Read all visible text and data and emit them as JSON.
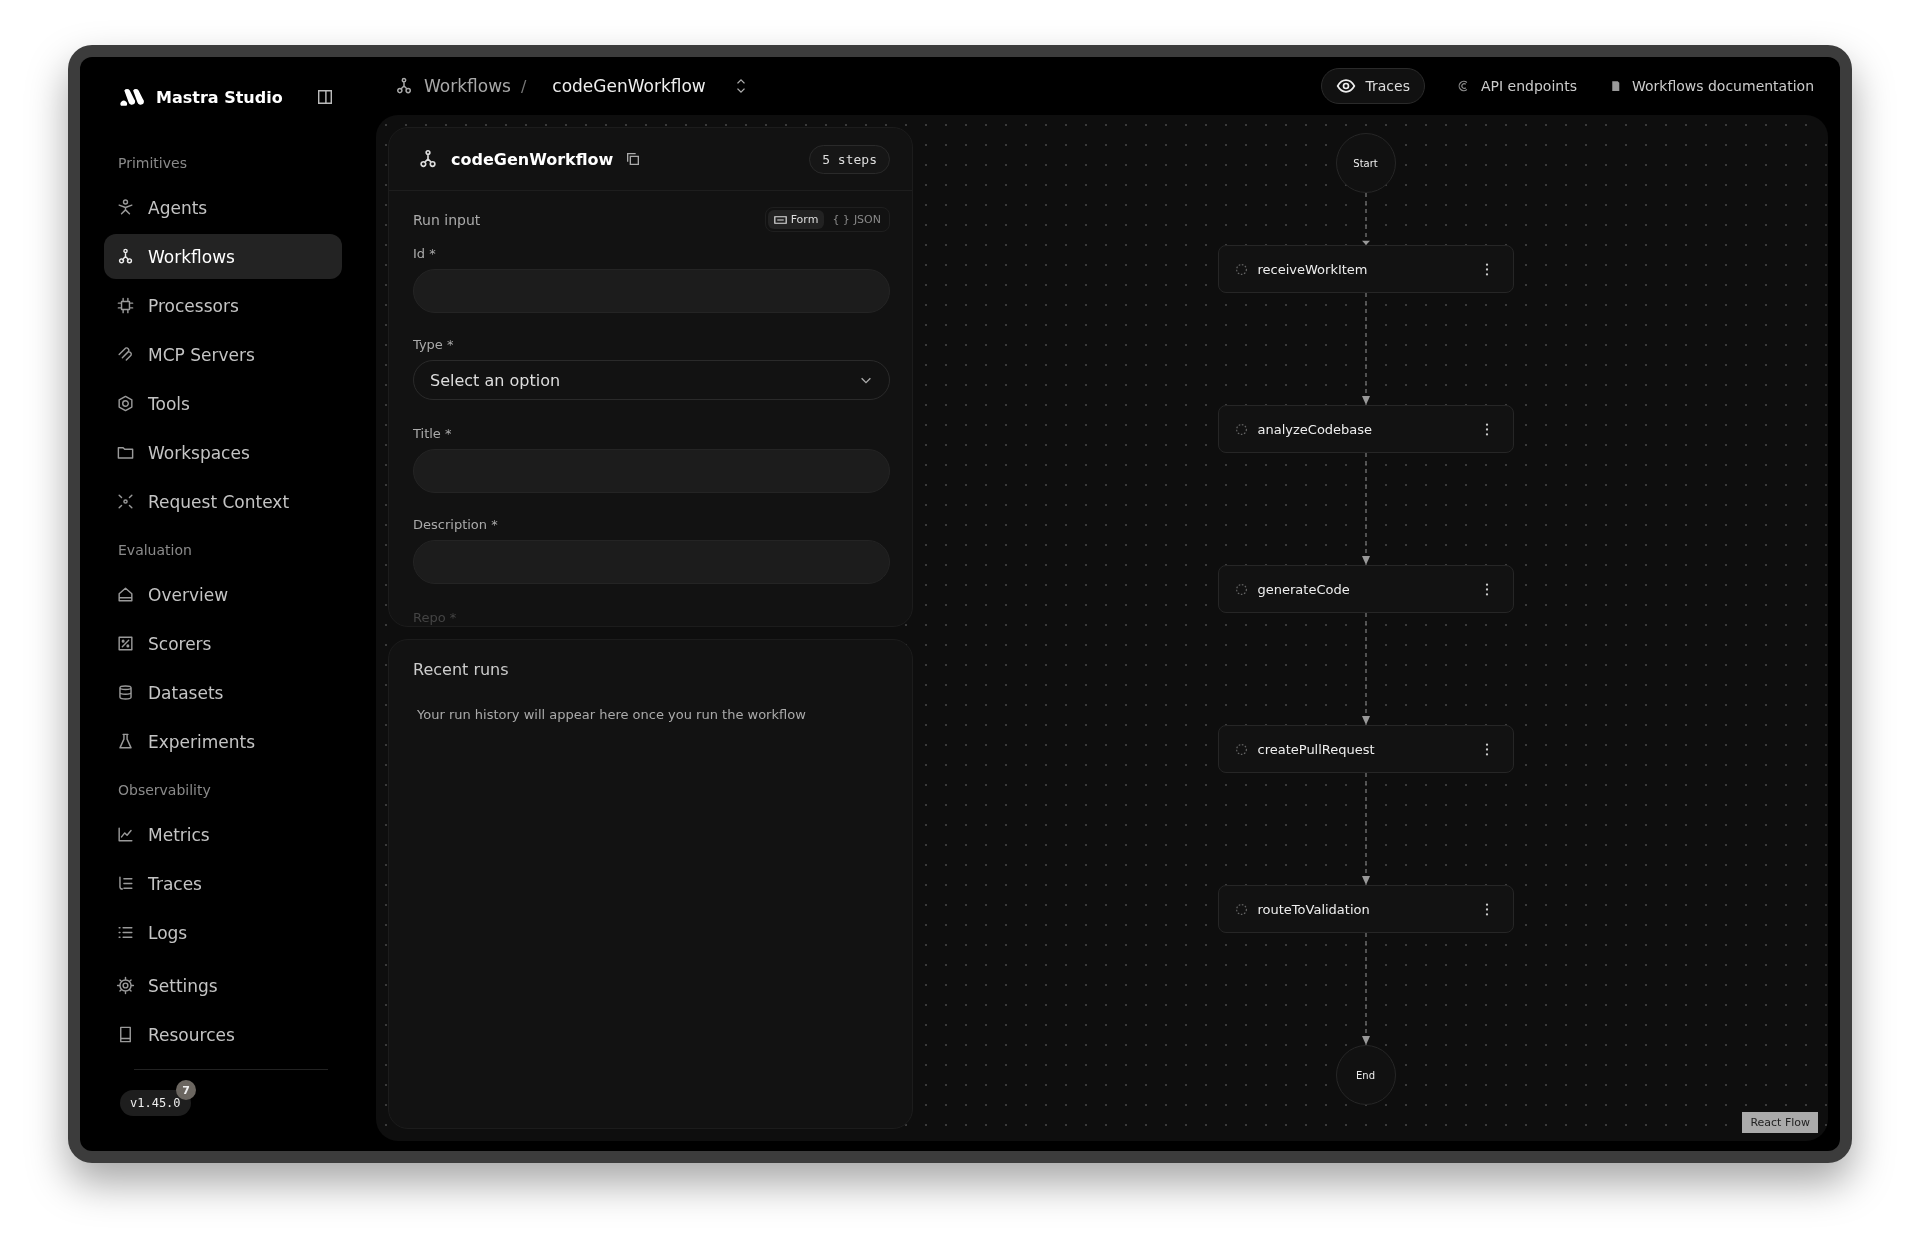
{
  "sidebar": {
    "brand": "Mastra Studio",
    "sections": [
      {
        "heading": "Primitives",
        "items": [
          {
            "label": "Agents",
            "selected": false
          },
          {
            "label": "Workflows",
            "selected": true
          },
          {
            "label": "Processors",
            "selected": false
          },
          {
            "label": "MCP Servers",
            "selected": false
          },
          {
            "label": "Tools",
            "selected": false
          },
          {
            "label": "Workspaces",
            "selected": false
          },
          {
            "label": "Request Context",
            "selected": false
          }
        ]
      },
      {
        "heading": "Evaluation",
        "items": [
          {
            "label": "Overview",
            "selected": false
          },
          {
            "label": "Scorers",
            "selected": false
          },
          {
            "label": "Datasets",
            "selected": false
          },
          {
            "label": "Experiments",
            "selected": false
          }
        ]
      },
      {
        "heading": "Observability",
        "items": [
          {
            "label": "Metrics",
            "selected": false
          },
          {
            "label": "Traces",
            "selected": false
          },
          {
            "label": "Logs",
            "selected": false
          }
        ]
      },
      {
        "items": [
          {
            "label": "Settings",
            "selected": false
          },
          {
            "label": "Resources",
            "selected": false
          }
        ]
      }
    ],
    "version": "v1.45.0",
    "version_badge": "7"
  },
  "breadcrumb": {
    "parent": "Workflows",
    "separator": "/",
    "current": "codeGenWorkflow"
  },
  "header_links": [
    {
      "label": "Traces",
      "kind": "pill"
    },
    {
      "label": "API endpoints",
      "kind": "link"
    },
    {
      "label": "Workflows documentation",
      "kind": "link"
    }
  ],
  "workflow_panel": {
    "title": "codeGenWorkflow",
    "steps_badge": "5 steps",
    "run_input_label": "Run input",
    "modes": [
      {
        "label": "Form",
        "selected": true
      },
      {
        "label": "JSON",
        "icon_text": "{ }",
        "selected": false
      }
    ],
    "fields": [
      {
        "label": "Id *",
        "kind": "text"
      },
      {
        "label": "Type *",
        "kind": "select",
        "placeholder": "Select an option"
      },
      {
        "label": "Title *",
        "kind": "text"
      },
      {
        "label": "Description *",
        "kind": "text"
      },
      {
        "label": "Repo *",
        "kind": "cut"
      }
    ]
  },
  "recent_runs": {
    "title": "Recent runs",
    "empty_message": "Your run history will appear here once you run the workflow"
  },
  "graph": {
    "start": "Start",
    "end": "End",
    "attribution": "React Flow",
    "steps": [
      {
        "label": "receiveWorkItem"
      },
      {
        "label": "analyzeCodebase"
      },
      {
        "label": "generateCode"
      },
      {
        "label": "createPullRequest"
      },
      {
        "label": "routeToValidation"
      }
    ]
  }
}
